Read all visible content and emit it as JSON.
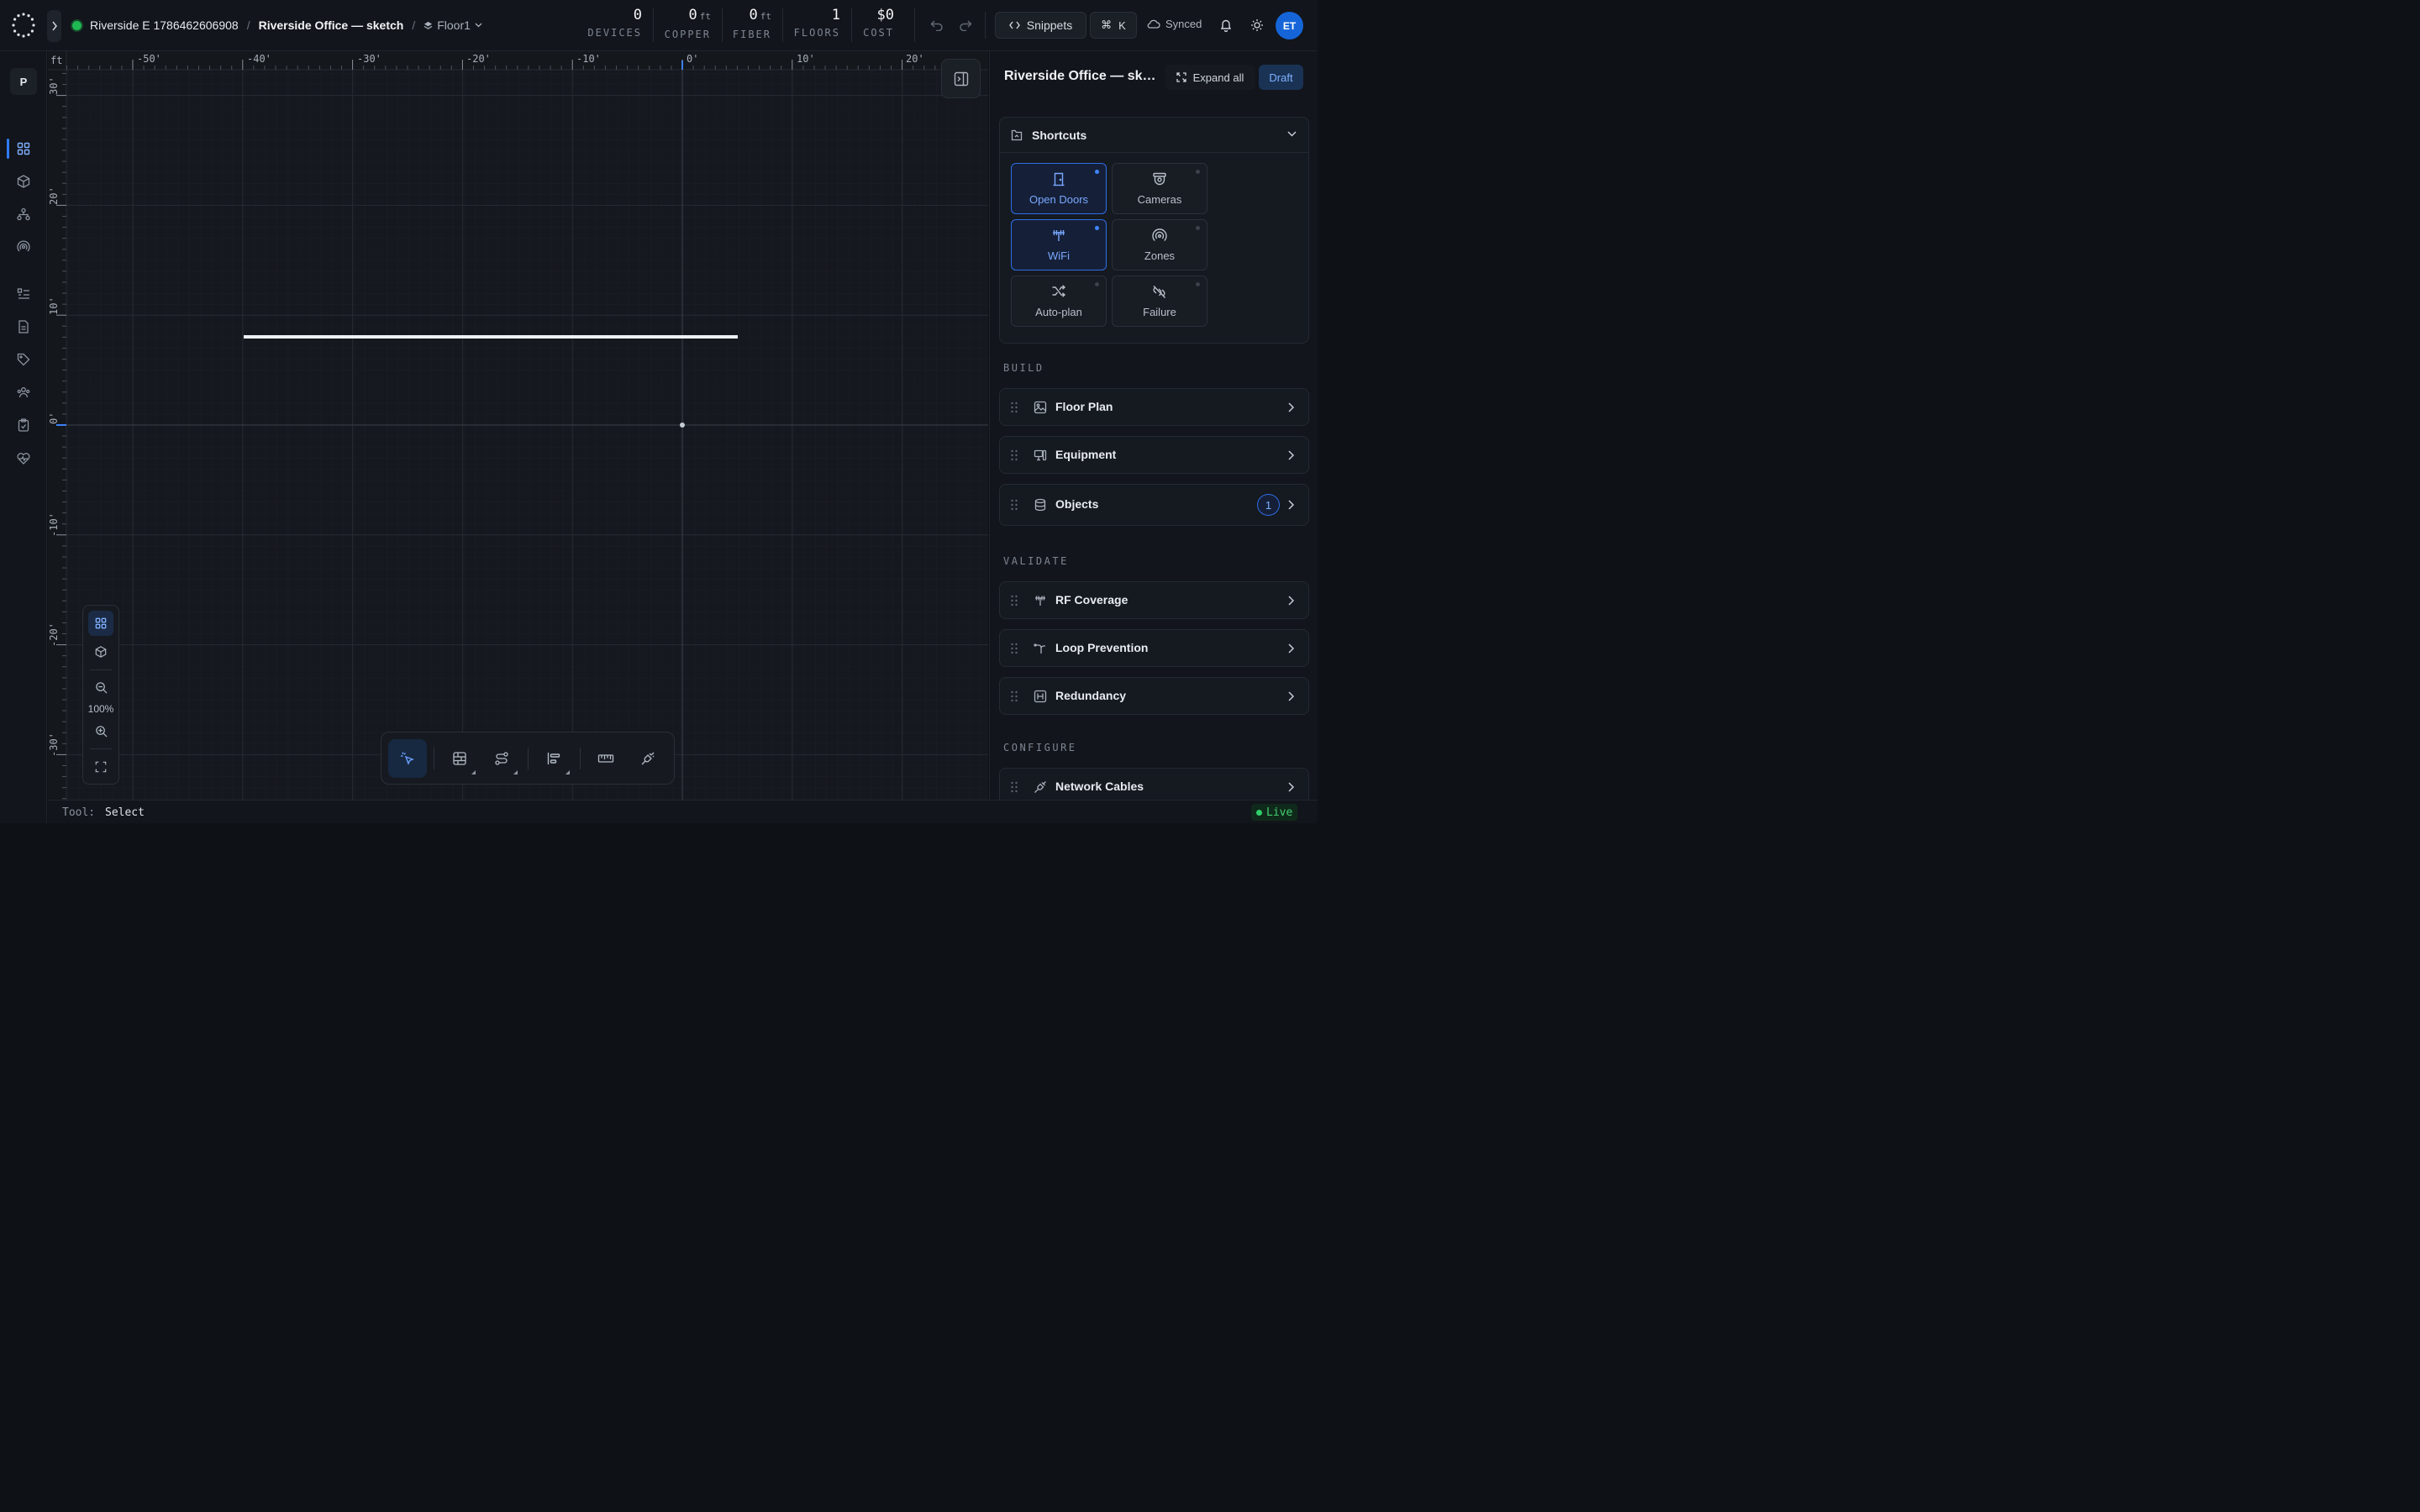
{
  "header": {
    "project_name": "Riverside E 1786462606908",
    "design_name": "Riverside Office — sketch",
    "floor_selector": "Floor1",
    "separator": "/",
    "stats": [
      {
        "value": "0",
        "unit": "",
        "label": "DEVICES"
      },
      {
        "value": "0",
        "unit": "ft",
        "label": "COPPER"
      },
      {
        "value": "0",
        "unit": "ft",
        "label": "FIBER"
      },
      {
        "value": "1",
        "unit": "",
        "label": "FLOORS"
      },
      {
        "value": "$0",
        "unit": "",
        "label": "COST"
      }
    ],
    "snippets_label": "Snippets",
    "command_shortcut": "K",
    "sync_status": "Synced",
    "user_initials": "ET",
    "status_color": "#1fb954"
  },
  "rail": {
    "workspace_initial": "P",
    "items": [
      "grid-icon",
      "cube-icon",
      "topology-icon",
      "wireless-icon",
      "list-icon",
      "document-icon",
      "tag-icon",
      "users-icon",
      "clipboard-icon",
      "health-icon"
    ],
    "active_index": 0
  },
  "canvas": {
    "unit_label": "ft",
    "x_ticks": [
      "-50'",
      "-40'",
      "-30'",
      "-20'",
      "-10'",
      "0'",
      "10'",
      "20'"
    ],
    "y_ticks": [
      "30'",
      "20'",
      "10'",
      "0'",
      "-10'",
      "-20'",
      "-30'"
    ],
    "zoom_level": "100%",
    "active_tool": "select",
    "object_count": 1
  },
  "statusbar": {
    "tool_label": "Tool:",
    "tool_value": "Select",
    "live_label": "Live"
  },
  "panel": {
    "title": "Riverside Office — sketch",
    "expand_all": "Expand all",
    "draft_badge": "Draft",
    "shortcuts_title": "Shortcuts",
    "shortcuts": [
      {
        "label": "Open Doors",
        "icon": "door-icon",
        "enabled": true
      },
      {
        "label": "Cameras",
        "icon": "camera-icon",
        "enabled": false
      },
      {
        "label": "WiFi",
        "icon": "antenna-icon",
        "enabled": true
      },
      {
        "label": "Zones",
        "icon": "zones-icon",
        "enabled": false
      },
      {
        "label": "Auto-plan",
        "icon": "shuffle-icon",
        "enabled": false
      },
      {
        "label": "Failure",
        "icon": "link-broken-icon",
        "enabled": false
      }
    ],
    "sections": {
      "build": "BUILD",
      "validate": "VALIDATE",
      "configure": "CONFIGURE"
    },
    "build_items": [
      "Floor Plan",
      "Equipment",
      "Objects"
    ],
    "objects_count": "1",
    "validate_items": [
      "RF Coverage",
      "Loop Prevention",
      "Redundancy"
    ],
    "configure_items": [
      "Network Cables"
    ]
  },
  "colors": {
    "accent": "#2f7cf6",
    "live_green": "#43cf72",
    "draft_blue": "#7fb0ff"
  }
}
